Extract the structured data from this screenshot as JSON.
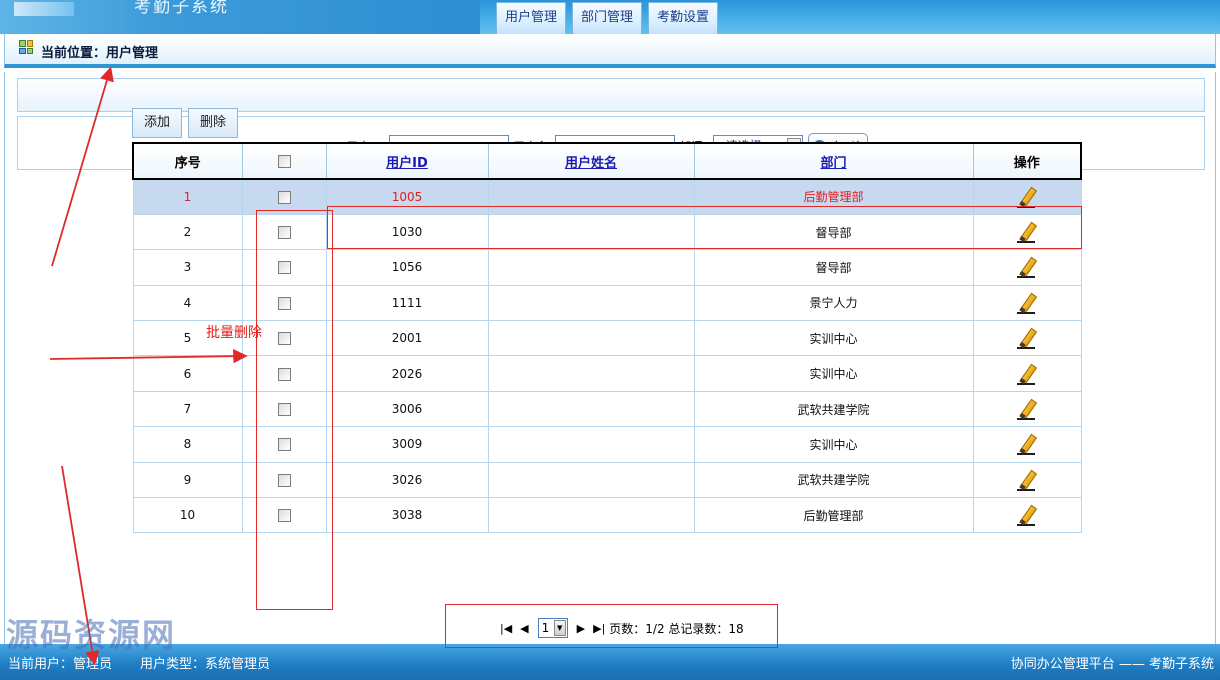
{
  "header": {
    "system_title": "考勤子系统",
    "tabs": [
      "用户管理",
      "部门管理",
      "考勤设置"
    ]
  },
  "breadcrumb": {
    "text": "当前位置：用户管理"
  },
  "search": {
    "user_id_label": "用户ID:",
    "user_id_value": "",
    "user_name_label": "用户名:",
    "user_name_value": "",
    "dept_label": "部门:",
    "dept_selected": "--请选择--",
    "search_label": "查 询"
  },
  "actions": {
    "add": "添加",
    "delete": "删除"
  },
  "table": {
    "headers": {
      "index": "序号",
      "user_id": "用户ID",
      "user_name": "用户姓名",
      "dept": "部门",
      "ops": "操作"
    },
    "rows": [
      {
        "index": "1",
        "user_id": "1005",
        "user_name": "",
        "dept": "后勤管理部"
      },
      {
        "index": "2",
        "user_id": "1030",
        "user_name": "",
        "dept": "督导部"
      },
      {
        "index": "3",
        "user_id": "1056",
        "user_name": "",
        "dept": "督导部"
      },
      {
        "index": "4",
        "user_id": "1111",
        "user_name": "",
        "dept": "景宁人力"
      },
      {
        "index": "5",
        "user_id": "2001",
        "user_name": "",
        "dept": "实训中心"
      },
      {
        "index": "6",
        "user_id": "2026",
        "user_name": "",
        "dept": "实训中心"
      },
      {
        "index": "7",
        "user_id": "3006",
        "user_name": "",
        "dept": "武软共建学院"
      },
      {
        "index": "8",
        "user_id": "3009",
        "user_name": "",
        "dept": "实训中心"
      },
      {
        "index": "9",
        "user_id": "3026",
        "user_name": "",
        "dept": "武软共建学院"
      },
      {
        "index": "10",
        "user_id": "3038",
        "user_name": "",
        "dept": "后勤管理部"
      }
    ]
  },
  "pager": {
    "current_page": "1",
    "summary": "页数：1/2 总记录数：18"
  },
  "annotation": {
    "batch_delete": "批量删除"
  },
  "footer": {
    "current_user": "当前用户：管理员",
    "user_type": "用户类型：系统管理员",
    "platform": "协同办公管理平台 —— 考勤子系统"
  },
  "watermark": "源码资源网",
  "colors": {
    "header_blue": "#47aee8",
    "footer_blue": "#1f7fc6",
    "selected_row": "#c7d9ef",
    "annotation_red": "#e02a2a"
  },
  "icons": {
    "breadcrumb": "grid-icon",
    "search": "magnifier-icon",
    "row_action": "edit-pencil-icon",
    "pager_first": "first-page-icon",
    "pager_prev": "prev-page-icon",
    "pager_next": "next-page-icon",
    "pager_last": "last-page-icon"
  }
}
